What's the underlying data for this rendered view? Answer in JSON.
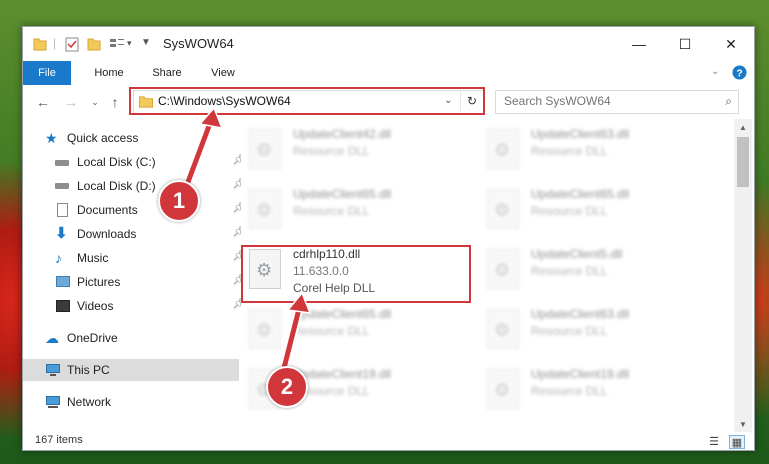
{
  "window": {
    "title": "SysWOW64",
    "controls": {
      "minimize": "—",
      "maximize": "☐",
      "close": "✕"
    }
  },
  "ribbon": {
    "tabs": [
      "File",
      "Home",
      "Share",
      "View"
    ]
  },
  "navigation": {
    "address": "C:\\Windows\\SysWOW64",
    "search_placeholder": "Search SysWOW64"
  },
  "sidebar": {
    "items": [
      {
        "label": "Quick access",
        "icon": "star-icon",
        "pinned": false
      },
      {
        "label": "Local Disk (C:)",
        "icon": "drive-icon",
        "pinned": true
      },
      {
        "label": "Local Disk (D:)",
        "icon": "drive-icon",
        "pinned": true
      },
      {
        "label": "Documents",
        "icon": "documents-icon",
        "pinned": true
      },
      {
        "label": "Downloads",
        "icon": "downloads-icon",
        "pinned": true
      },
      {
        "label": "Music",
        "icon": "music-icon",
        "pinned": true
      },
      {
        "label": "Pictures",
        "icon": "pictures-icon",
        "pinned": true
      },
      {
        "label": "Videos",
        "icon": "videos-icon",
        "pinned": true
      },
      {
        "label": "OneDrive",
        "icon": "cloud-icon",
        "pinned": false
      },
      {
        "label": "This PC",
        "icon": "computer-icon",
        "pinned": false,
        "selected": true
      },
      {
        "label": "Network",
        "icon": "network-icon",
        "pinned": false
      }
    ]
  },
  "files": [
    {
      "name": "UpdateClient42.dll",
      "line2": "Resource DLL",
      "blurred": true
    },
    {
      "name": "UpdateClient63.dll",
      "line2": "Resource DLL",
      "blurred": true
    },
    {
      "name": "UpdateClient65.dll",
      "line2": "Resource DLL",
      "blurred": true
    },
    {
      "name": "UpdateClient65.dll",
      "line2": "Resource DLL",
      "blurred": true
    },
    {
      "name": "cdrhlp110.dll",
      "line2": "11.633.0.0",
      "line3": "Corel Help DLL",
      "blurred": false,
      "highlighted": true
    },
    {
      "name": "UpdateClient5.dll",
      "line2": "Resource DLL",
      "blurred": true
    },
    {
      "name": "UpdateClient65.dll",
      "line2": "Resource DLL",
      "blurred": true
    },
    {
      "name": "UpdateClient63.dll",
      "line2": "Resource DLL",
      "blurred": true
    },
    {
      "name": "UpdateClient19.dll",
      "line2": "Resource DLL",
      "blurred": true
    },
    {
      "name": "UpdateClient19.dll",
      "line2": "Resource DLL",
      "blurred": true
    }
  ],
  "status": {
    "item_count": "167 items"
  },
  "annotations": {
    "step1": "1",
    "step2": "2"
  },
  "colors": {
    "accent": "#1979ca",
    "highlight": "#d1373a"
  }
}
